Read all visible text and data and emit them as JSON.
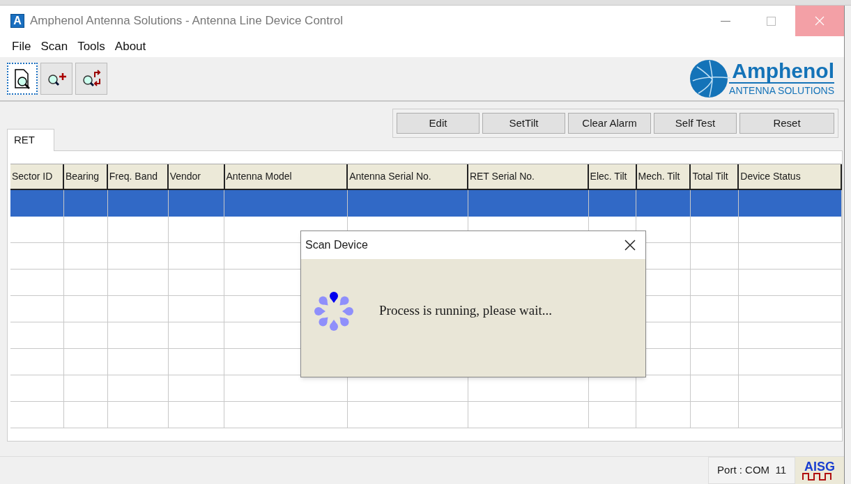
{
  "window": {
    "icon_letter": "A",
    "title": "Amphenol Antenna Solutions - Antenna Line Device Control"
  },
  "menu": [
    "File",
    "Scan",
    "Tools",
    "About"
  ],
  "toolbar": [
    {
      "kind": "scan",
      "selected": true
    },
    {
      "kind": "add",
      "selected": false
    },
    {
      "kind": "refresh",
      "selected": false
    }
  ],
  "logo": {
    "name": "Amphenol",
    "tagline": "ANTENNA SOLUTIONS"
  },
  "tabs": [
    {
      "label": "RET",
      "selected": true
    }
  ],
  "actions": [
    "Edit",
    "SetTilt",
    "Clear Alarm",
    "Self Test",
    "Reset"
  ],
  "table": {
    "columns": [
      "Sector ID",
      "Bearing",
      "Freq. Band",
      "Vendor",
      "Antenna Model",
      "Antenna Serial No.",
      "RET Serial No.",
      "Elec. Tilt",
      "Mech. Tilt",
      "Total Tilt",
      "Device Status"
    ],
    "rows": [
      {
        "selected": true
      },
      {
        "selected": false
      },
      {
        "selected": false
      },
      {
        "selected": false
      },
      {
        "selected": false
      },
      {
        "selected": false
      },
      {
        "selected": false
      },
      {
        "selected": false
      },
      {
        "selected": false
      }
    ]
  },
  "dialog": {
    "title": "Scan Device",
    "message": "Process is running, please wait..."
  },
  "status_bar": {
    "port": "Port : COM  11",
    "badge": "AISG"
  }
}
